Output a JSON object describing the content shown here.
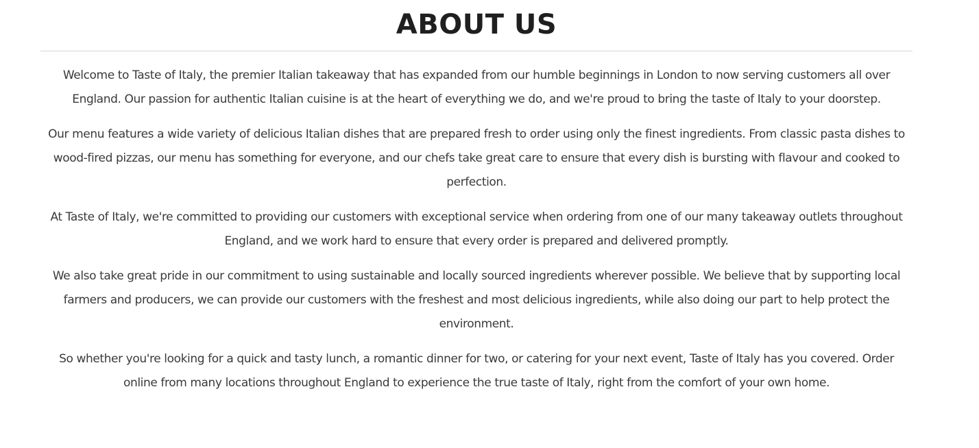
{
  "about": {
    "title": "ABOUT US",
    "paragraphs": [
      "Welcome to Taste of Italy, the premier Italian takeaway that has expanded from our humble beginnings in London to now serving customers all over England. Our passion for authentic Italian cuisine is at the heart of everything we do, and we're proud to bring the taste of Italy to your doorstep.",
      "Our menu features a wide variety of delicious Italian dishes that are prepared fresh to order using only the finest ingredients. From classic pasta dishes to wood-fired pizzas, our menu has something for everyone, and our chefs take great care to ensure that every dish is bursting with flavour and cooked to perfection.",
      "At Taste of Italy, we're committed to providing our customers with exceptional service when ordering from one of our many takeaway outlets throughout England, and we work hard to ensure that every order is prepared and delivered promptly.",
      "We also take great pride in our commitment to using sustainable and locally sourced ingredients wherever possible. We believe that by supporting local farmers and producers, we can provide our customers with the freshest and most delicious ingredients, while also doing our part to help protect the environment.",
      "So whether you're looking for a quick and tasty lunch, a romantic dinner for two, or catering for your next event, Taste of Italy has you covered. Order online from many locations throughout England to experience the true taste of Italy, right from the comfort of your own home."
    ]
  },
  "colors": {
    "background": "#ffffff",
    "heading": "#1f1f1f",
    "body_text": "#3a3a3a",
    "divider": "#d6d6d6"
  }
}
